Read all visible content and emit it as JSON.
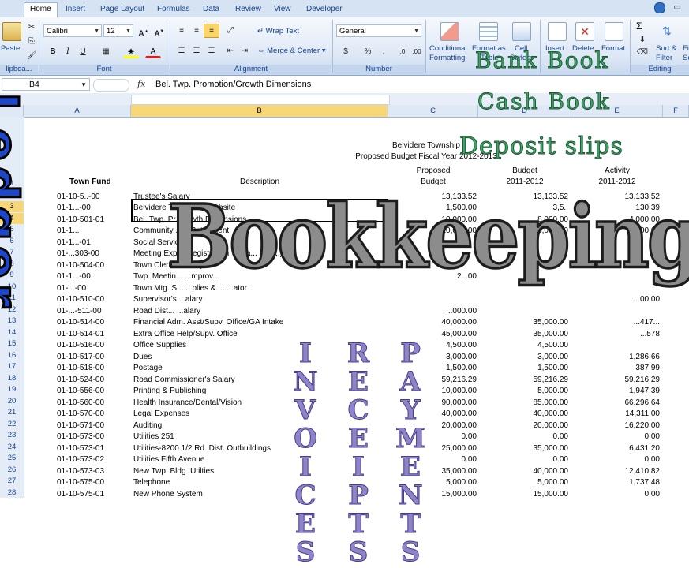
{
  "ribbon": {
    "tabs": [
      "Home",
      "Insert",
      "Page Layout",
      "Formulas",
      "Data",
      "Review",
      "View",
      "Developer"
    ],
    "active_tab": "Home",
    "paste_label": "Paste",
    "clipboard_group": "lipboa...",
    "font_name": "Calibri",
    "font_size": "12",
    "font_group": "Font",
    "alignment_group": "Alignment",
    "wrap_text": "Wrap Text",
    "merge_center": "Merge & Center",
    "number_format": "General",
    "number_group": "Number",
    "currency": "$",
    "percent": "%",
    "comma": ",",
    "cond_format_1": "Conditional",
    "cond_format_2": "Formatting",
    "format_as_1": "Format as",
    "format_as_2": "Table",
    "cell_styles_1": "Cell",
    "cell_styles_2": "Styles",
    "insert": "Insert",
    "delete": "Delete",
    "format": "Format",
    "editing_group": "Editing",
    "sort_1": "Sort &",
    "sort_2": "Filter",
    "find_1": "Fi",
    "find_2": "Se",
    "sigma": "Σ"
  },
  "formula_bar": {
    "name_box": "B4",
    "fx": "fx",
    "formula": "Bel. Twp. Promotion/Growth Dimensions"
  },
  "columns": [
    "A",
    "B",
    "C",
    "D",
    "E",
    "F"
  ],
  "rows": [
    "1",
    "2",
    "3",
    "4",
    "5",
    "6",
    "7",
    "8",
    "9",
    "10",
    "11",
    "12",
    "13",
    "14",
    "15",
    "16",
    "17",
    "18",
    "19",
    "20",
    "21",
    "22",
    "23",
    "24",
    "25",
    "26",
    "27",
    "28"
  ],
  "sheet": {
    "org": "Belvidere Township",
    "title": "Proposed Budget Fiscal Year 2012-2013",
    "col_a": "Town Fund",
    "col_b": "Description",
    "col_c1": "Proposed",
    "col_c2": "Budget",
    "col_d1": "Budget",
    "col_d2": "2011-2012",
    "col_e1": "Activity",
    "col_e2": "2011-2012",
    "rows": [
      {
        "a": "01-10-5..-00",
        "b": "Trustee's Salary",
        "c": "13,133.52",
        "d": "13,133.52",
        "e": "13,133.52"
      },
      {
        "a": "01-1...-00",
        "b": "Belvidere T... ...otion/Website",
        "c": "1,500.00",
        "d": "3,5..",
        "e": "130.39"
      },
      {
        "a": "01-10-501-01",
        "b": "Bel. Twp. Pr... ...wth Dimensions",
        "c": "10,000.00",
        "d": "8,000.00",
        "e": "4,000.00"
      },
      {
        "a": "01-1...",
        "b": "Community ...p. Bett...ment",
        "c": "10,000.00",
        "d": "6,000.00",
        "e": "500.00"
      },
      {
        "a": "01-1...-01",
        "b": "Social Servic...",
        "c": "",
        "d": "",
        "e": ""
      },
      {
        "a": "01-...303-00",
        "b": "Meeting Exp... ...egistration, ...lea... & M...)",
        "c": "",
        "d": "",
        "e": ""
      },
      {
        "a": "01-10-504-00",
        "b": "Town Clerk's ...alary",
        "c": "",
        "d": "",
        "e": ""
      },
      {
        "a": "01-1...-00",
        "b": "Twp. Meetin... ...mprov...",
        "c": "2...00",
        "d": "",
        "e": ""
      },
      {
        "a": "01-...-00",
        "b": "Town Mtg. S... ...plies & ... ...ator",
        "c": "",
        "d": "",
        "e": ""
      },
      {
        "a": "01-10-510-00",
        "b": "Supervisor's ...alary",
        "c": "",
        "d": "",
        "e": "...00.00"
      },
      {
        "a": "01-...-511-00",
        "b": "Road Dist... ...alary",
        "c": "...000.00",
        "d": "",
        "e": ""
      },
      {
        "a": "01-10-514-00",
        "b": "Financial Adm. Asst/Supv. Office/GA Intake",
        "c": "40,000.00",
        "d": "35,000.00",
        "e": "...417..."
      },
      {
        "a": "01-10-514-01",
        "b": "Extra Office Help/Supv. Office",
        "c": "45,000.00",
        "d": "35,000.00",
        "e": "...578"
      },
      {
        "a": "01-10-516-00",
        "b": "Office Supplies",
        "c": "4,500.00",
        "d": "4,500.00",
        "e": ""
      },
      {
        "a": "01-10-517-00",
        "b": "Dues",
        "c": "3,000.00",
        "d": "3,000.00",
        "e": "1,286.66"
      },
      {
        "a": "01-10-518-00",
        "b": "Postage",
        "c": "1,500.00",
        "d": "1,500.00",
        "e": "387.99"
      },
      {
        "a": "01-10-524-00",
        "b": "Road Commissioner's Salary",
        "c": "59,216.29",
        "d": "59,216.29",
        "e": "59,216.29"
      },
      {
        "a": "01-10-556-00",
        "b": "Printing & Publishing",
        "c": "10,000.00",
        "d": "5,000.00",
        "e": "1,947.39"
      },
      {
        "a": "01-10-560-00",
        "b": "Health Insurance/Dental/Vision",
        "c": "90,000.00",
        "d": "85,000.00",
        "e": "66,296.64"
      },
      {
        "a": "01-10-570-00",
        "b": "Legal Expenses",
        "c": "40,000.00",
        "d": "40,000.00",
        "e": "14,311.00"
      },
      {
        "a": "01-10-571-00",
        "b": "Auditing",
        "c": "20,000.00",
        "d": "20,000.00",
        "e": "16,220.00"
      },
      {
        "a": "01-10-573-00",
        "b": "Utilities 251",
        "c": "0.00",
        "d": "0.00",
        "e": "0.00"
      },
      {
        "a": "01-10-573-01",
        "b": "Utilities-8200 1/2 Rd. Dist. Outbuildings",
        "c": "25,000.00",
        "d": "35,000.00",
        "e": "6,431.20"
      },
      {
        "a": "01-10-573-02",
        "b": "Utilities Fifth Avenue",
        "c": "0.00",
        "d": "0.00",
        "e": "0.00"
      },
      {
        "a": "01-10-573-03",
        "b": "New Twp. Bldg. Utilties",
        "c": "35,000.00",
        "d": "40,000.00",
        "e": "12,410.82"
      },
      {
        "a": "01-10-575-00",
        "b": "Telephone",
        "c": "5,000.00",
        "d": "5,000.00",
        "e": "1,737.48"
      },
      {
        "a": "01-10-575-01",
        "b": "New Phone System",
        "c": "15,000.00",
        "d": "15,000.00",
        "e": "0.00"
      }
    ]
  },
  "overlay": {
    "bank_book": "Bank Book",
    "cash_book": "Cash Book",
    "deposit_slips": "Deposit slips",
    "bookkeeping": "Bookkeeping",
    "ledger": "Ledger",
    "invoices": [
      "I",
      "N",
      "V",
      "O",
      "I",
      "C",
      "E",
      "S"
    ],
    "receipts": [
      "R",
      "E",
      "C",
      "E",
      "I",
      "P",
      "T",
      "S"
    ],
    "payments": [
      "P",
      "A",
      "Y",
      "M",
      "E",
      "N",
      "T",
      "S"
    ]
  }
}
